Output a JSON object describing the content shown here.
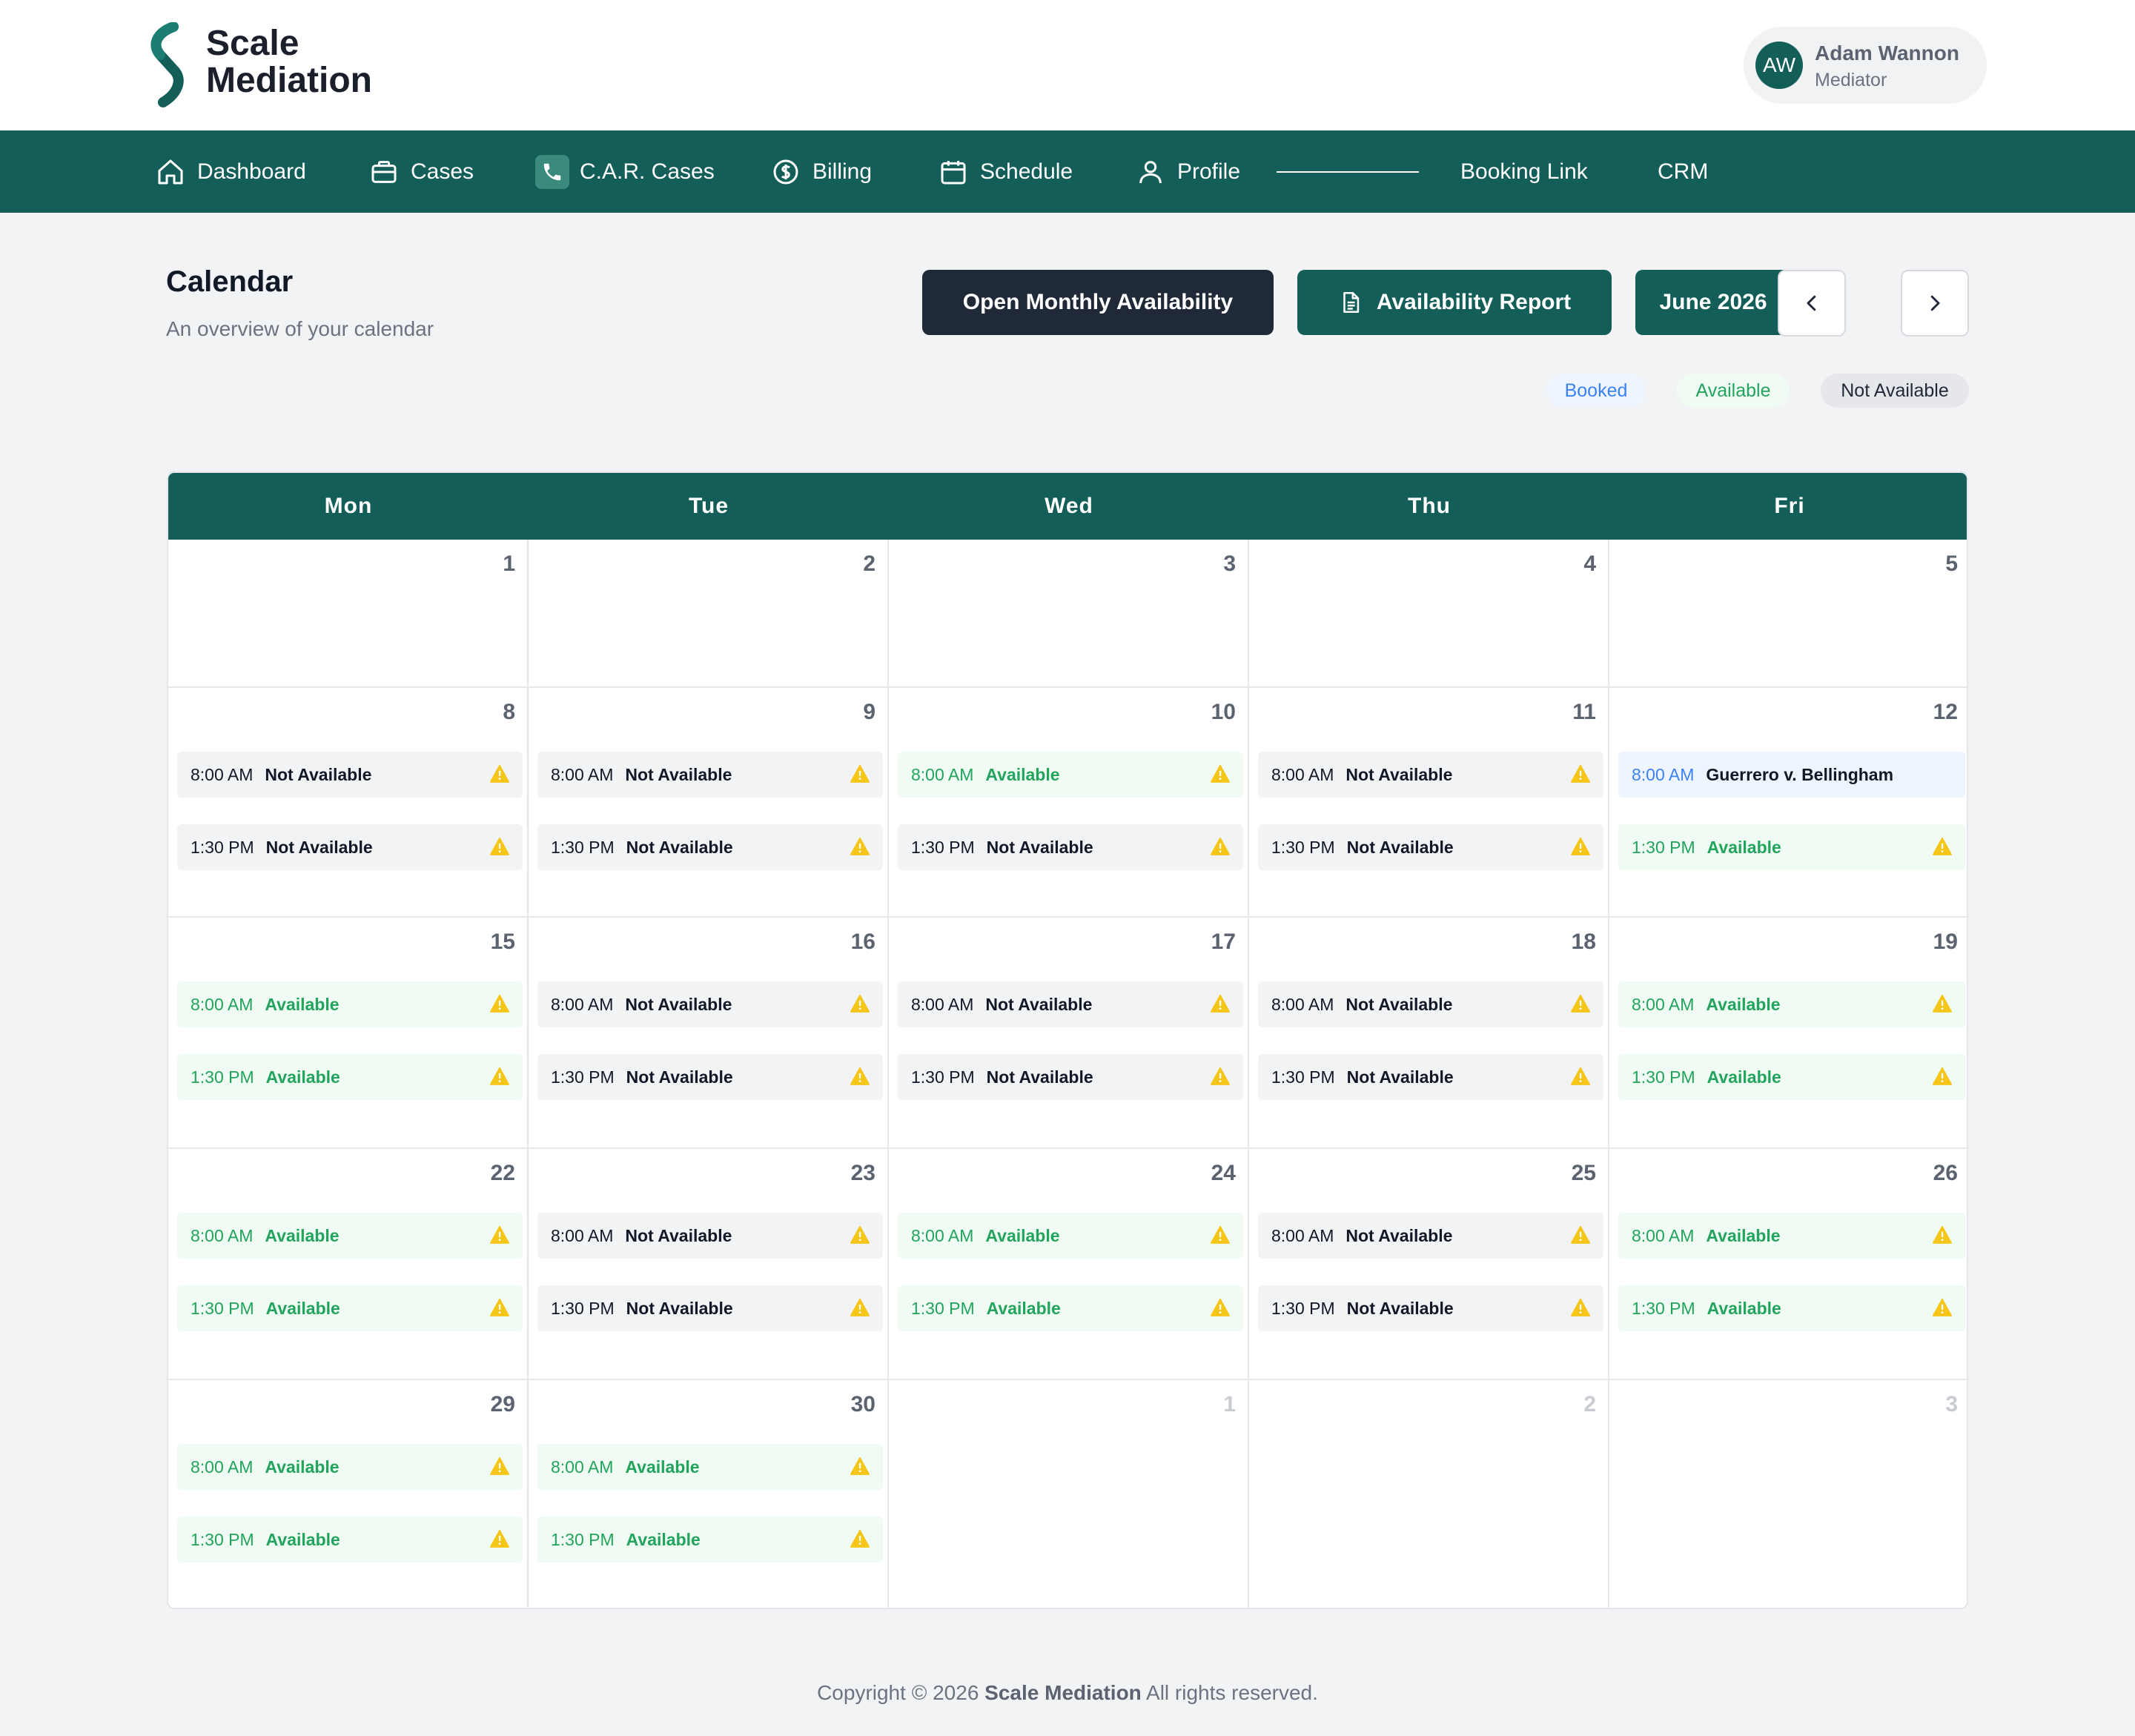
{
  "brand": {
    "line1": "Scale",
    "line2": "Mediation"
  },
  "user": {
    "initials": "AW",
    "name": "Adam Wannon",
    "role": "Mediator"
  },
  "nav": [
    {
      "label": "Dashboard",
      "icon": "home-icon"
    },
    {
      "label": "Cases",
      "icon": "briefcase-icon"
    },
    {
      "label": "C.A.R. Cases",
      "icon": "phone-icon"
    },
    {
      "label": "Billing",
      "icon": "dollar-circle-icon"
    },
    {
      "label": "Schedule",
      "icon": "calendar-icon"
    },
    {
      "label": "Profile",
      "icon": "user-icon"
    },
    {
      "label": "Booking Link"
    },
    {
      "label": "CRM"
    }
  ],
  "page": {
    "title": "Calendar",
    "subtitle": "An overview of your calendar"
  },
  "actions": {
    "open_monthly": "Open Monthly Availability",
    "report": "Availability Report",
    "month": "June 2026"
  },
  "legend": {
    "booked": "Booked",
    "available": "Available",
    "not_available": "Not Available"
  },
  "colors": {
    "brand_green": "#135e58",
    "dark": "#1f2937",
    "available": "#22a45d",
    "booked": "#3b82f6",
    "warning": "#f5c518"
  },
  "calendar": {
    "days": [
      "Mon",
      "Tue",
      "Wed",
      "Thu",
      "Fri"
    ],
    "weeks": [
      [
        {
          "date": "1",
          "slots": []
        },
        {
          "date": "2",
          "slots": []
        },
        {
          "date": "3",
          "slots": []
        },
        {
          "date": "4",
          "slots": []
        },
        {
          "date": "5",
          "slots": []
        }
      ],
      [
        {
          "date": "8",
          "slots": [
            {
              "time": "8:00 AM",
              "status": "Not Available",
              "type": "na"
            },
            {
              "time": "1:30 PM",
              "status": "Not Available",
              "type": "na"
            }
          ]
        },
        {
          "date": "9",
          "slots": [
            {
              "time": "8:00 AM",
              "status": "Not Available",
              "type": "na"
            },
            {
              "time": "1:30 PM",
              "status": "Not Available",
              "type": "na"
            }
          ]
        },
        {
          "date": "10",
          "slots": [
            {
              "time": "8:00 AM",
              "status": "Available",
              "type": "av"
            },
            {
              "time": "1:30 PM",
              "status": "Not Available",
              "type": "na"
            }
          ]
        },
        {
          "date": "11",
          "slots": [
            {
              "time": "8:00 AM",
              "status": "Not Available",
              "type": "na"
            },
            {
              "time": "1:30 PM",
              "status": "Not Available",
              "type": "na"
            }
          ]
        },
        {
          "date": "12",
          "slots": [
            {
              "time": "8:00 AM",
              "status": "Guerrero v. Bellingham",
              "type": "bk"
            },
            {
              "time": "1:30 PM",
              "status": "Available",
              "type": "av"
            }
          ]
        }
      ],
      [
        {
          "date": "15",
          "slots": [
            {
              "time": "8:00 AM",
              "status": "Available",
              "type": "av"
            },
            {
              "time": "1:30 PM",
              "status": "Available",
              "type": "av"
            }
          ]
        },
        {
          "date": "16",
          "slots": [
            {
              "time": "8:00 AM",
              "status": "Not Available",
              "type": "na"
            },
            {
              "time": "1:30 PM",
              "status": "Not Available",
              "type": "na"
            }
          ]
        },
        {
          "date": "17",
          "slots": [
            {
              "time": "8:00 AM",
              "status": "Not Available",
              "type": "na"
            },
            {
              "time": "1:30 PM",
              "status": "Not Available",
              "type": "na"
            }
          ]
        },
        {
          "date": "18",
          "slots": [
            {
              "time": "8:00 AM",
              "status": "Not Available",
              "type": "na"
            },
            {
              "time": "1:30 PM",
              "status": "Not Available",
              "type": "na"
            }
          ]
        },
        {
          "date": "19",
          "slots": [
            {
              "time": "8:00 AM",
              "status": "Available",
              "type": "av"
            },
            {
              "time": "1:30 PM",
              "status": "Available",
              "type": "av"
            }
          ]
        }
      ],
      [
        {
          "date": "22",
          "slots": [
            {
              "time": "8:00 AM",
              "status": "Available",
              "type": "av"
            },
            {
              "time": "1:30 PM",
              "status": "Available",
              "type": "av"
            }
          ]
        },
        {
          "date": "23",
          "slots": [
            {
              "time": "8:00 AM",
              "status": "Not Available",
              "type": "na"
            },
            {
              "time": "1:30 PM",
              "status": "Not Available",
              "type": "na"
            }
          ]
        },
        {
          "date": "24",
          "slots": [
            {
              "time": "8:00 AM",
              "status": "Available",
              "type": "av"
            },
            {
              "time": "1:30 PM",
              "status": "Available",
              "type": "av"
            }
          ]
        },
        {
          "date": "25",
          "slots": [
            {
              "time": "8:00 AM",
              "status": "Not Available",
              "type": "na"
            },
            {
              "time": "1:30 PM",
              "status": "Not Available",
              "type": "na"
            }
          ]
        },
        {
          "date": "26",
          "slots": [
            {
              "time": "8:00 AM",
              "status": "Available",
              "type": "av"
            },
            {
              "time": "1:30 PM",
              "status": "Available",
              "type": "av"
            }
          ]
        }
      ],
      [
        {
          "date": "29",
          "slots": [
            {
              "time": "8:00 AM",
              "status": "Available",
              "type": "av"
            },
            {
              "time": "1:30 PM",
              "status": "Available",
              "type": "av"
            }
          ]
        },
        {
          "date": "30",
          "slots": [
            {
              "time": "8:00 AM",
              "status": "Available",
              "type": "av"
            },
            {
              "time": "1:30 PM",
              "status": "Available",
              "type": "av"
            }
          ]
        },
        {
          "date": "1",
          "muted": true,
          "slots": []
        },
        {
          "date": "2",
          "muted": true,
          "slots": []
        },
        {
          "date": "3",
          "muted": true,
          "slots": []
        }
      ]
    ]
  },
  "footer": {
    "prefix": "Copyright © 2026",
    "brand": "Scale Mediation",
    "suffix": "All rights reserved."
  }
}
